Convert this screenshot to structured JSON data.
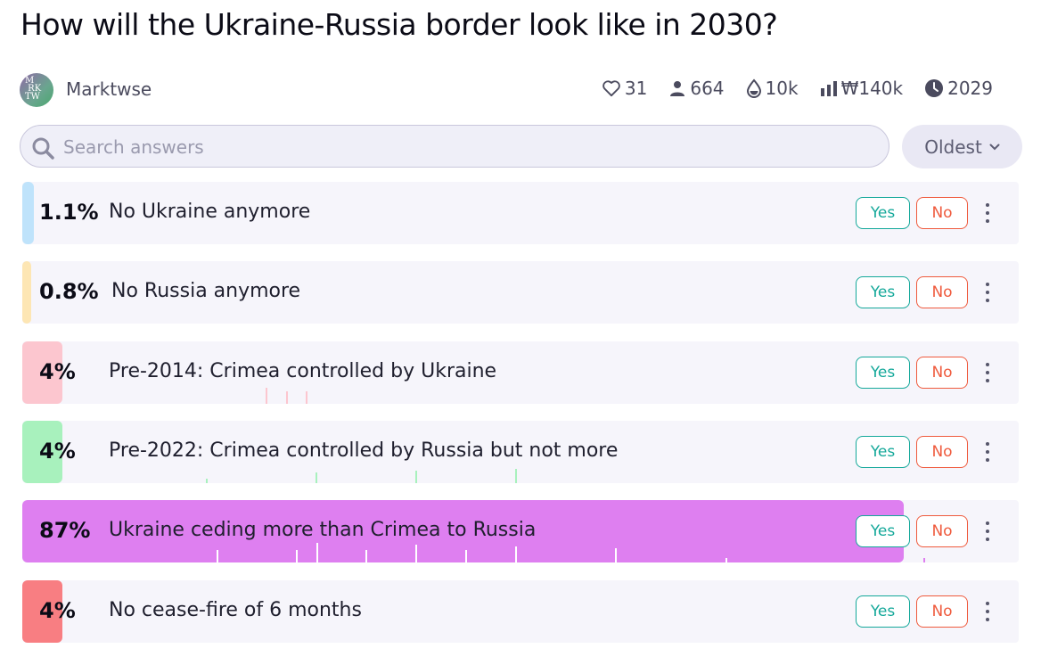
{
  "title": "How will the Ukraine-Russia border look like in 2030?",
  "author": "Marktwse",
  "avatar_text": "M RK TW",
  "stats": {
    "likes": "31",
    "traders": "664",
    "liquidity": "10k",
    "volume": "₩140k",
    "close_year": "2029"
  },
  "search": {
    "placeholder": "Search answers",
    "value": ""
  },
  "sort": {
    "label": "Oldest"
  },
  "buttons": {
    "yes": "Yes",
    "no": "No"
  },
  "answers": [
    {
      "pct": "1.1%",
      "label": "No Ukraine anymore",
      "probability": 0.011,
      "bar_color": "#bfe3fb"
    },
    {
      "pct": "0.8%",
      "label": "No Russia anymore",
      "probability": 0.008,
      "bar_color": "#fde6b4"
    },
    {
      "pct": "4%",
      "label": "Pre-2014: Crimea controlled by Ukraine",
      "probability": 0.04,
      "bar_color": "#fcc6cf"
    },
    {
      "pct": "4%",
      "label": "Pre-2022: Crimea controlled by Russia but not more",
      "probability": 0.04,
      "bar_color": "#a8f1bd"
    },
    {
      "pct": "87%",
      "label": "Ukraine ceding more than Crimea to Russia",
      "probability": 0.87,
      "bar_color": "#de7ff0"
    },
    {
      "pct": "4%",
      "label": "No cease-fire of 6 months",
      "probability": 0.04,
      "bar_color": "#f87e82"
    }
  ]
}
